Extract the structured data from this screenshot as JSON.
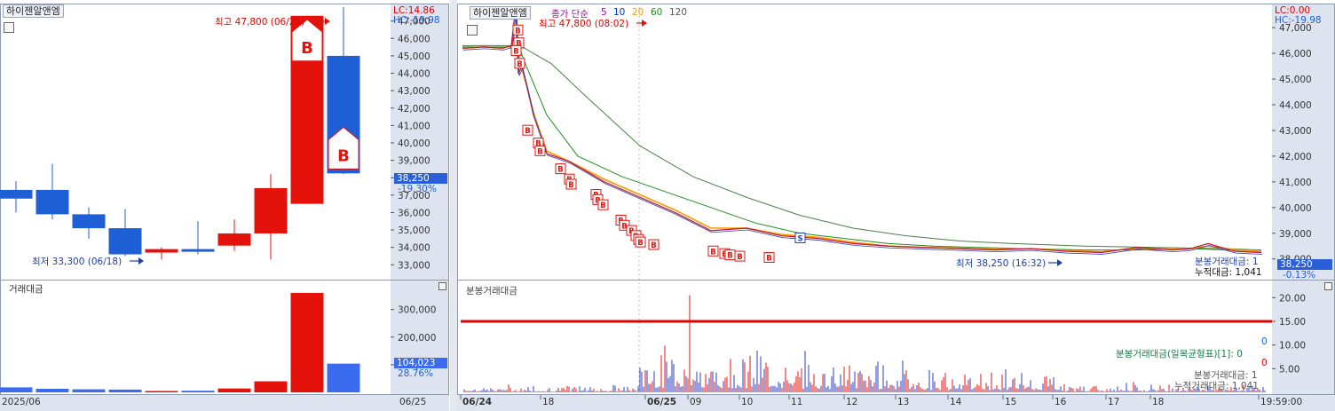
{
  "colors": {
    "up": "#e3130c",
    "down": "#1f5fd6",
    "avg5": "#ff9900",
    "avg20": "#228822",
    "avg60": "#2f7f2f",
    "ref": "#e30000",
    "axis_bg": "#dde3ef"
  },
  "left": {
    "title": "하이젠알앤엠",
    "lc": "LC:14.86",
    "hc": "HC:-19.98",
    "high_label": "최고 47,800 (06/25)",
    "low_label": "최저 33,300 (06/18)",
    "price_box": "38,250",
    "change_box": "-19.30%",
    "vol_title": "거래대금",
    "vol_box": "104,023",
    "vol_pct": "28.76%",
    "date_left": "2025/06",
    "date_right": "06/25"
  },
  "right": {
    "title": "하이젠알앤엠",
    "ma_prefix": "종가 단순",
    "ma_periods": [
      "5",
      "10",
      "20",
      "60",
      "120"
    ],
    "lc": "LC:0.00",
    "hc": "HC:-19.98",
    "high_label": "최고 47,800 (08:02)",
    "low_label": "최저 38,250 (16:32)",
    "info_a": "분봉거래대금: 1",
    "info_b": "누적대금: 1,041",
    "price_box": "38,250",
    "change_box": "-0.13%",
    "vol_title": "분봉거래대금",
    "vol_info": [
      "0",
      "분봉거래대금(일목균형표)[1]: 0",
      "0",
      "분봉거래대금: 1",
      "누적거래대금: 1,041"
    ],
    "time_labels": [
      "06/24",
      "18",
      "06/25",
      "09",
      "10",
      "11",
      "12",
      "13",
      "14",
      "15",
      "16",
      "17",
      "18",
      "19:59:00"
    ]
  },
  "chart_data": [
    {
      "type": "candlestick",
      "ylim": [
        32300,
        47800
      ],
      "yticks": [
        33000,
        34000,
        35000,
        36000,
        37000,
        38000,
        39000,
        40000,
        41000,
        42000,
        43000,
        44000,
        45000,
        46000,
        47000
      ],
      "candles": [
        {
          "o": 37300,
          "c": 36800,
          "h": 37800,
          "l": 36000
        },
        {
          "o": 37300,
          "c": 35900,
          "h": 38800,
          "l": 35600
        },
        {
          "o": 35900,
          "c": 35100,
          "h": 36300,
          "l": 34500
        },
        {
          "o": 35100,
          "c": 33600,
          "h": 36200,
          "l": 33500
        },
        {
          "o": 33700,
          "c": 33900,
          "h": 34000,
          "l": 33300
        },
        {
          "o": 33900,
          "c": 33800,
          "h": 35500,
          "l": 33600
        },
        {
          "o": 34100,
          "c": 34800,
          "h": 35600,
          "l": 33800
        },
        {
          "o": 34800,
          "c": 37400,
          "h": 38200,
          "l": 33300
        },
        {
          "o": 36500,
          "c": 47300,
          "h": 47300,
          "l": 36500
        },
        {
          "o": 45000,
          "c": 38250,
          "h": 47800,
          "l": 38200
        }
      ],
      "buy_markers": [
        8,
        9
      ]
    },
    {
      "type": "bar",
      "title": "거래대금",
      "ylim": [
        0,
        360000
      ],
      "yticks": [
        100000,
        200000,
        300000
      ],
      "values": [
        18000,
        13000,
        11000,
        10000,
        5000,
        6000,
        14000,
        40000,
        360000,
        104023
      ]
    },
    {
      "type": "line",
      "ylim": [
        37300,
        47800
      ],
      "yticks": [
        38000,
        39000,
        40000,
        41000,
        42000,
        43000,
        44000,
        45000,
        46000,
        47000
      ],
      "series": [
        {
          "name": "price",
          "x": [
            0,
            25,
            45,
            55,
            60,
            63,
            67,
            72,
            80,
            95,
            120,
            160,
            200,
            240,
            280,
            320,
            360,
            400,
            440,
            480,
            520,
            560,
            600,
            640,
            680,
            720,
            760,
            800,
            820,
            840,
            870,
            900
          ],
          "values": [
            46200,
            46250,
            46200,
            46300,
            47800,
            45200,
            45500,
            44800,
            43600,
            42100,
            41800,
            41000,
            40400,
            39800,
            39100,
            39200,
            38900,
            38800,
            38600,
            38500,
            38450,
            38400,
            38350,
            38400,
            38300,
            38250,
            38450,
            38350,
            38400,
            38600,
            38300,
            38250
          ]
        },
        {
          "name": "5",
          "x": [
            0,
            25,
            45,
            55,
            60,
            63,
            67,
            72,
            80,
            95,
            120,
            160,
            200,
            240,
            280,
            320,
            360,
            400,
            440,
            480,
            520,
            560,
            600,
            640,
            680,
            720,
            760,
            800,
            820,
            840,
            870,
            900
          ],
          "values": [
            46200,
            46250,
            46200,
            46300,
            46900,
            46000,
            45400,
            44800,
            43700,
            42200,
            41800,
            41100,
            40500,
            39900,
            39200,
            39200,
            38950,
            38850,
            38650,
            38500,
            38450,
            38420,
            38380,
            38400,
            38330,
            38280,
            38420,
            38380,
            38400,
            38500,
            38360,
            38280
          ]
        },
        {
          "name": "20",
          "x": [
            0,
            55,
            63,
            72,
            95,
            130,
            180,
            230,
            280,
            330,
            380,
            430,
            480,
            530,
            580,
            640,
            700,
            760,
            820,
            900
          ],
          "values": [
            46250,
            46250,
            46300,
            45500,
            43600,
            42000,
            41200,
            40600,
            40000,
            39400,
            39000,
            38800,
            38600,
            38500,
            38450,
            38400,
            38350,
            38350,
            38400,
            38300
          ]
        },
        {
          "name": "60",
          "x": [
            0,
            55,
            70,
            100,
            140,
            200,
            260,
            320,
            380,
            440,
            500,
            560,
            620,
            700,
            780,
            860,
            900
          ],
          "values": [
            46300,
            46300,
            46200,
            45600,
            44300,
            42400,
            41200,
            40400,
            39700,
            39200,
            38900,
            38700,
            38600,
            38500,
            38450,
            38400,
            38350
          ]
        }
      ],
      "buy_markers": [
        [
          62,
          47100
        ],
        [
          63,
          46600
        ],
        [
          60,
          46300
        ],
        [
          64,
          45800
        ],
        [
          73,
          43200
        ],
        [
          85,
          42700
        ],
        [
          87,
          42400
        ],
        [
          110,
          41700
        ],
        [
          120,
          41300
        ],
        [
          122,
          41100
        ],
        [
          150,
          40700
        ],
        [
          152,
          40500
        ],
        [
          158,
          40300
        ],
        [
          178,
          39700
        ],
        [
          182,
          39500
        ],
        [
          190,
          39300
        ],
        [
          195,
          39100
        ],
        [
          198,
          38950
        ],
        [
          200,
          38850
        ],
        [
          215,
          38750
        ],
        [
          282,
          38500
        ],
        [
          295,
          38400
        ],
        [
          301,
          38350
        ],
        [
          312,
          38300
        ],
        [
          345,
          38250
        ]
      ],
      "sell_markers": [
        [
          380,
          38700
        ]
      ]
    },
    {
      "type": "bar",
      "title": "분봉거래대금",
      "ylim": [
        0,
        21
      ],
      "yticks": [
        5,
        10,
        15,
        20
      ],
      "reference_line": 15
    }
  ]
}
